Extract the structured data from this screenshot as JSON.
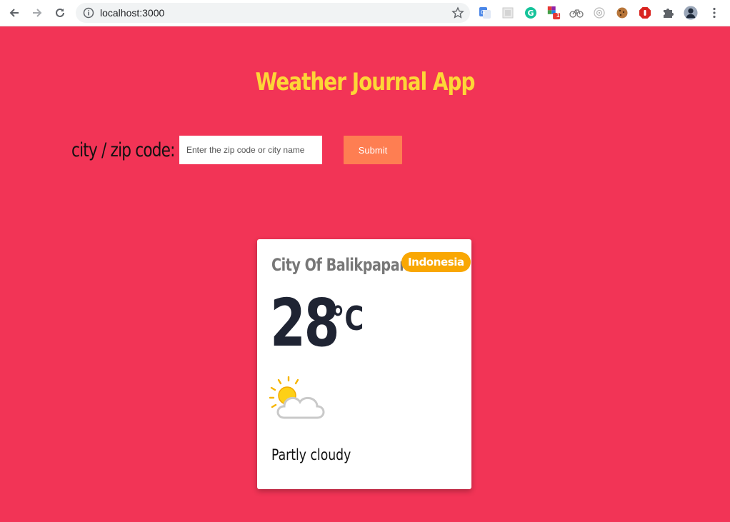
{
  "browser": {
    "url": "localhost:3000",
    "extensions": [
      "google-translate-icon",
      "screen-capture-icon",
      "grammarly-icon",
      "badge-extension-icon",
      "bike-icon",
      "target-icon",
      "cookie-icon",
      "adblock-icon",
      "puzzle-icon",
      "profile-avatar-icon",
      "more-menu-icon"
    ],
    "extension_badge": "1"
  },
  "app": {
    "title": "Weather Journal App"
  },
  "form": {
    "label": "city / zip code:",
    "placeholder": "Enter the zip code or city name",
    "value": "",
    "submit_label": "Submit"
  },
  "card": {
    "city": "City Of Balikpapan",
    "country": "Indonesia",
    "temperature": "28",
    "unit": "°C",
    "weather_icon": "partly-cloudy-icon",
    "description": "Partly cloudy"
  },
  "colors": {
    "page_background": "#f23456",
    "title": "#fdd637",
    "submit": "#fe7e52",
    "badge": "#f9a703",
    "temperature": "#1f2433"
  }
}
